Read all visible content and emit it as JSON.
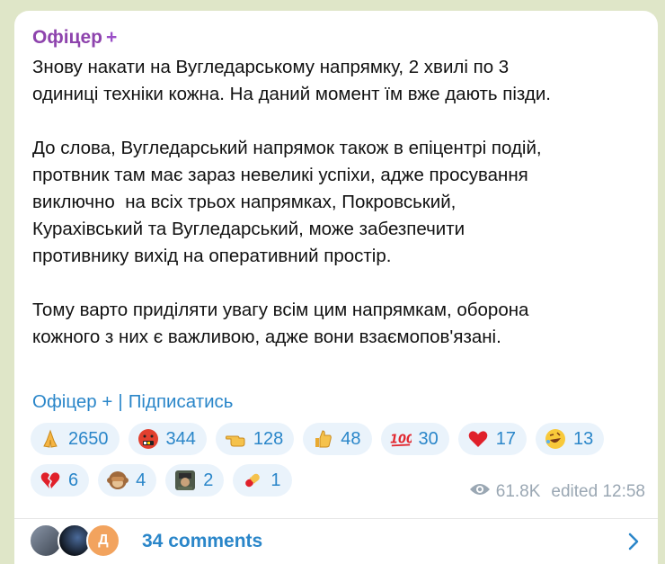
{
  "post": {
    "channel_name": "Офіцер",
    "channel_badge": "+",
    "paragraphs": [
      "Знову накати на Вугледарському напрямку, 2 хвилі по 3\nодиниці техніки кожна. На даний момент їм вже дають пізди.",
      "До слова, Вугледарський напрямок також в епіцентрі подій,\nпротвник там має зараз невеликі успіхи, адже просування\nвиключно  на всіх трьох напрямках, Покровський,\nКурахівський та Вугледарський, може забезпечити\nпротивнику вихід на оперативний простір.",
      "Тому варто приділяти увагу всім цим напрямкам, оборона\nкожного з них є важливою, адже вони взаємопов'язані."
    ],
    "footer_channel": "Офіцер +",
    "footer_separator": "|",
    "subscribe_label": "Підписатись",
    "reactions_row1": [
      {
        "icon": "folded-hands-icon",
        "count": "2650"
      },
      {
        "icon": "cursing-face-icon",
        "count": "344"
      },
      {
        "icon": "pointing-hand-icon",
        "count": "128"
      },
      {
        "icon": "thumbs-up-icon",
        "count": "48"
      },
      {
        "icon": "hundred-points-icon",
        "count": "30"
      },
      {
        "icon": "red-heart-icon",
        "count": "17"
      },
      {
        "icon": "rofl-face-icon",
        "count": "13"
      }
    ],
    "reactions_row2": [
      {
        "icon": "broken-heart-icon",
        "count": "6"
      },
      {
        "icon": "see-no-evil-monkey-icon",
        "count": "4"
      },
      {
        "icon": "custom-sticker-icon",
        "count": "2"
      },
      {
        "icon": "pill-icon",
        "count": "1"
      }
    ],
    "views": "61.8K",
    "edited": "edited 12:58",
    "comments_label": "34 comments",
    "commenter_initial": "Д"
  },
  "colors": {
    "accent": "#2a86c9",
    "channel": "#8e44ad",
    "reaction_bg": "#eaf3fb",
    "background": "#dfe6c8"
  }
}
